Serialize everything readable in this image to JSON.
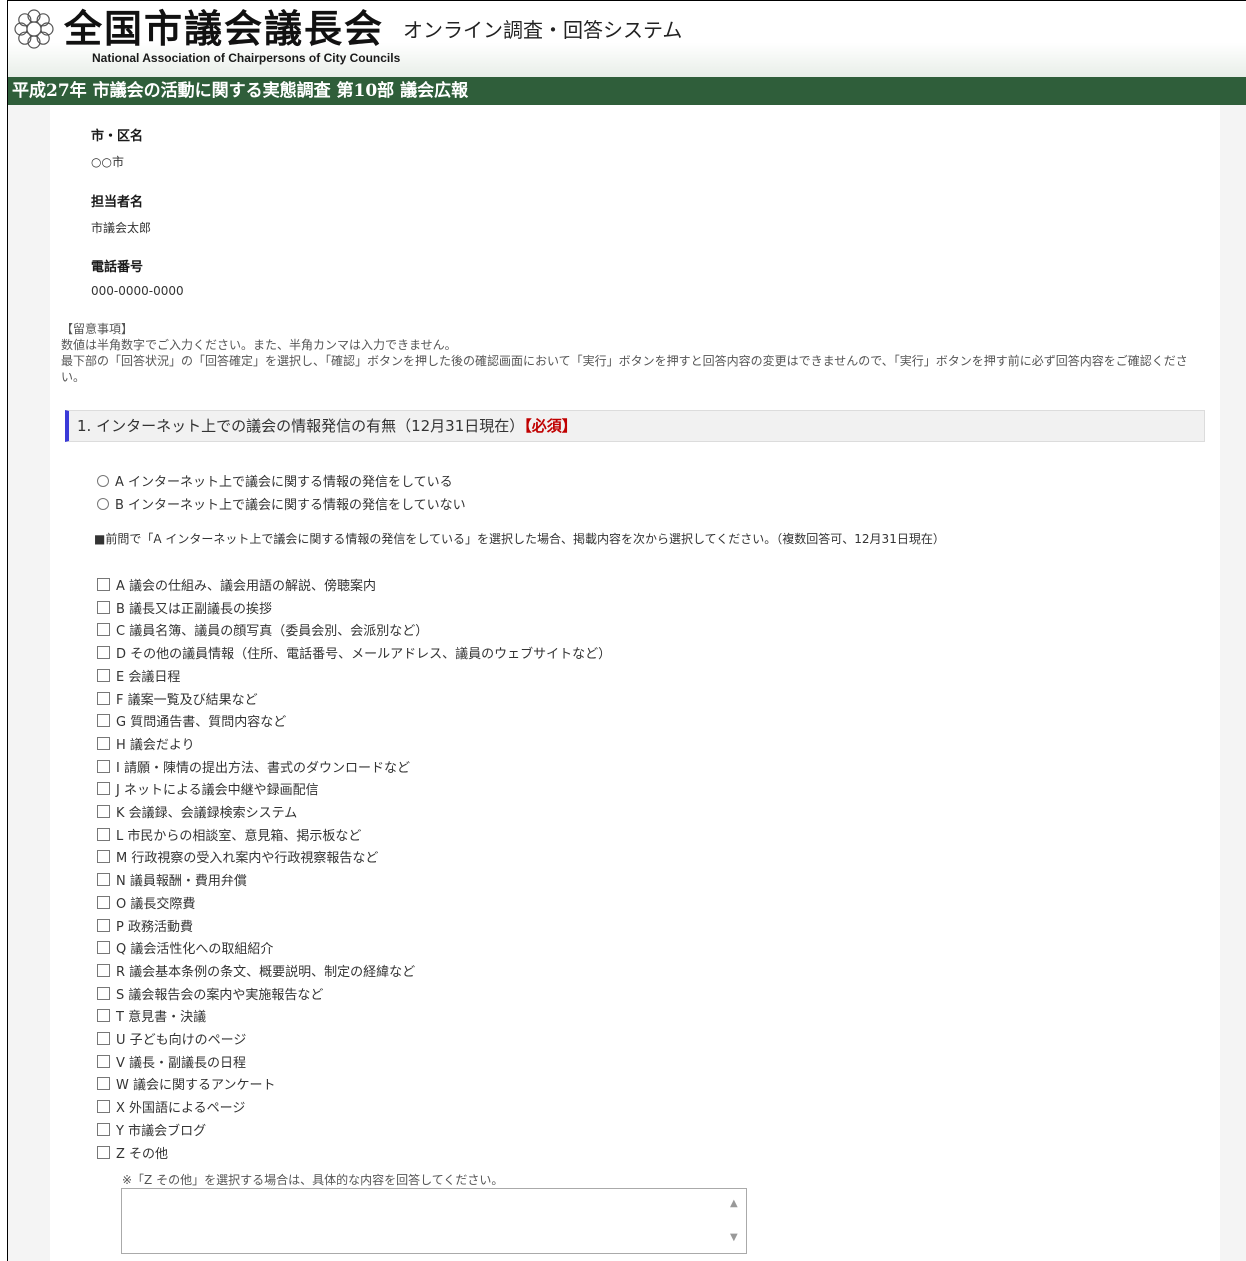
{
  "header": {
    "title": "全国市議会議長会",
    "subtitle": "オンライン調査・回答システム",
    "english_name": "National Association of Chairpersons of City Councils"
  },
  "survey_title": "平成27年 市議会の活動に関する実態調査 第10部 議会広報",
  "info": {
    "city_label": "市・区名",
    "city_value": "○○市",
    "person_label": "担当者名",
    "person_value": "市議会太郎",
    "phone_label": "電話番号",
    "phone_value": "000-0000-0000"
  },
  "notes": {
    "heading": "【留意事項】",
    "line1": "数値は半角数字でご入力ください。また、半角カンマは入力できません。",
    "line2": "最下部の「回答状況」の「回答確定」を選択し、「確認」ボタンを押した後の確認画面において「実行」ボタンを押すと回答内容の変更はできませんので、「実行」ボタンを押す前に必ず回答内容をご確認ください。"
  },
  "question1": {
    "title": "1. インターネット上での議会の情報発信の有無（12月31日現在）",
    "required": "【必須】",
    "radio_options": [
      "A インターネット上で議会に関する情報の発信をしている",
      "B インターネット上で議会に関する情報の発信をしていない"
    ],
    "sub_question": "■前問で「A インターネット上で議会に関する情報の発信をしている」を選択した場合、掲載内容を次から選択してください。（複数回答可、12月31日現在）",
    "checkbox_options": [
      "A 議会の仕組み、議会用語の解説、傍聴案内",
      "B 議長又は正副議長の挨拶",
      "C 議員名簿、議員の顔写真（委員会別、会派別など）",
      "D その他の議員情報（住所、電話番号、メールアドレス、議員のウェブサイトなど）",
      "E 会議日程",
      "F 議案一覧及び結果など",
      "G 質問通告書、質問内容など",
      "H 議会だより",
      "I 請願・陳情の提出方法、書式のダウンロードなど",
      "J ネットによる議会中継や録画配信",
      "K 会議録、会議録検索システム",
      "L 市民からの相談室、意見箱、掲示板など",
      "M 行政視察の受入れ案内や行政視察報告など",
      "N 議員報酬・費用弁償",
      "O 議長交際費",
      "P 政務活動費",
      "Q 議会活性化への取組紹介",
      "R 議会基本条例の条文、概要説明、制定の経緯など",
      "S 議会報告会の案内や実施報告など",
      "T 意見書・決議",
      "U 子ども向けのページ",
      "V 議長・副議長の日程",
      "W 議会に関するアンケート",
      "X 外国語によるページ",
      "Y 市議会ブログ",
      "Z その他"
    ],
    "other_hint": "※「Z その他」を選択する場合は、具体的な内容を回答してください。"
  }
}
